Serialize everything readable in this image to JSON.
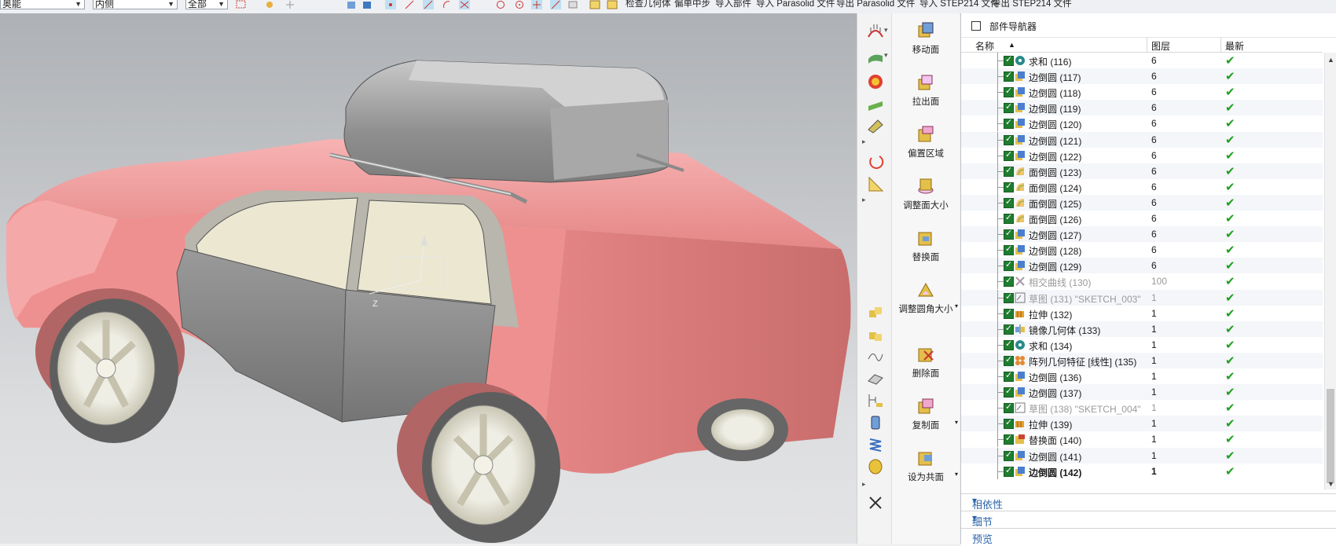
{
  "toolbar": {
    "select1": "奥能",
    "select2": "内侧",
    "select3": "全部",
    "commands": [
      "检查几何体",
      "偏单中步",
      "导入部件",
      "导入 Parasolid 文件",
      "导出 Parasolid 文件",
      "导入 STEP214 文件",
      "导出 STEP214 文件"
    ]
  },
  "viewport": {
    "axis_label": "Z",
    "colors": {
      "body": "#f39a9a",
      "door": "#8f8f8f",
      "window": "#eae6cf",
      "roof_box": "#9b9b9b"
    }
  },
  "ribbon": {
    "commands": [
      {
        "label": "移动面",
        "icon": "move-face-icon"
      },
      {
        "label": "拉出面",
        "icon": "pull-face-icon"
      },
      {
        "label": "偏置区域",
        "icon": "offset-region-icon"
      },
      {
        "label": "调整面大小",
        "icon": "resize-face-icon"
      },
      {
        "label": "替换面",
        "icon": "replace-face-icon"
      },
      {
        "label": "调整圆角大小",
        "icon": "resize-blend-icon"
      },
      {
        "label": "删除面",
        "icon": "delete-face-icon"
      },
      {
        "label": "复制面",
        "icon": "copy-face-icon"
      },
      {
        "label": "设为共面",
        "icon": "make-coplanar-icon"
      }
    ]
  },
  "navigator": {
    "title": "部件导航器",
    "columns": {
      "name": "名称",
      "layer": "图层",
      "latest": "最新"
    },
    "rows": [
      {
        "name": "求和 (116)",
        "layer": "6",
        "icon": "unite-icon"
      },
      {
        "name": "边倒圆 (117)",
        "layer": "6",
        "icon": "edge-blend-icon"
      },
      {
        "name": "边倒圆 (118)",
        "layer": "6",
        "icon": "edge-blend-icon"
      },
      {
        "name": "边倒圆 (119)",
        "layer": "6",
        "icon": "edge-blend-icon"
      },
      {
        "name": "边倒圆 (120)",
        "layer": "6",
        "icon": "edge-blend-icon"
      },
      {
        "name": "边倒圆 (121)",
        "layer": "6",
        "icon": "edge-blend-icon"
      },
      {
        "name": "边倒圆 (122)",
        "layer": "6",
        "icon": "edge-blend-icon"
      },
      {
        "name": "面倒圆 (123)",
        "layer": "6",
        "icon": "face-blend-icon"
      },
      {
        "name": "面倒圆 (124)",
        "layer": "6",
        "icon": "face-blend-icon"
      },
      {
        "name": "面倒圆 (125)",
        "layer": "6",
        "icon": "face-blend-icon"
      },
      {
        "name": "面倒圆 (126)",
        "layer": "6",
        "icon": "face-blend-icon"
      },
      {
        "name": "边倒圆 (127)",
        "layer": "6",
        "icon": "edge-blend-icon"
      },
      {
        "name": "边倒圆 (128)",
        "layer": "6",
        "icon": "edge-blend-icon"
      },
      {
        "name": "边倒圆 (129)",
        "layer": "6",
        "icon": "edge-blend-icon"
      },
      {
        "name": "相交曲线 (130)",
        "layer": "100",
        "icon": "intersection-curve-icon",
        "grey": true
      },
      {
        "name": "草图 (131) \"SKETCH_003\"",
        "layer": "1",
        "icon": "sketch-icon",
        "grey": true
      },
      {
        "name": "拉伸 (132)",
        "layer": "1",
        "icon": "extrude-icon"
      },
      {
        "name": "镜像几何体 (133)",
        "layer": "1",
        "icon": "mirror-icon"
      },
      {
        "name": "求和 (134)",
        "layer": "1",
        "icon": "unite-icon"
      },
      {
        "name": "阵列几何特征 [线性] (135)",
        "layer": "1",
        "icon": "pattern-icon"
      },
      {
        "name": "边倒圆 (136)",
        "layer": "1",
        "icon": "edge-blend-icon"
      },
      {
        "name": "边倒圆 (137)",
        "layer": "1",
        "icon": "edge-blend-icon"
      },
      {
        "name": "草图 (138) \"SKETCH_004\"",
        "layer": "1",
        "icon": "sketch-icon",
        "grey": true
      },
      {
        "name": "拉伸 (139)",
        "layer": "1",
        "icon": "extrude-icon"
      },
      {
        "name": "替换面 (140)",
        "layer": "1",
        "icon": "replace-face-icon"
      },
      {
        "name": "边倒圆 (141)",
        "layer": "1",
        "icon": "edge-blend-icon"
      },
      {
        "name": "边倒圆 (142)",
        "layer": "1",
        "icon": "edge-blend-icon",
        "bold": true
      }
    ],
    "panels": [
      "相依性",
      "细节",
      "预览"
    ]
  }
}
